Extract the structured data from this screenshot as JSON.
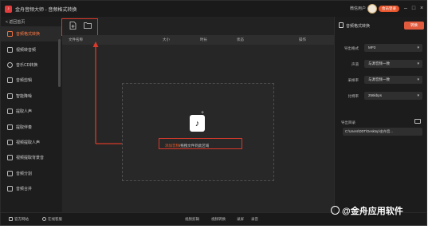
{
  "titlebar": {
    "title": "金舟音频大师 - 音频格式转换",
    "user_name": "微信用户",
    "vip_label": "会员登录",
    "minimize": "–",
    "maximize": "□",
    "close": "×"
  },
  "sidebar": {
    "back_label": "< 返回首页",
    "items": [
      {
        "label": "音频格式转换",
        "active": true
      },
      {
        "label": "视频转音频"
      },
      {
        "label": "音乐CD转换"
      },
      {
        "label": "音频剪辑"
      },
      {
        "label": "智能降噪"
      },
      {
        "label": "提取人声"
      },
      {
        "label": "提取伴奏"
      },
      {
        "label": "视频提取人声"
      },
      {
        "label": "视频提取背景音"
      },
      {
        "label": "音频分割"
      },
      {
        "label": "音频合并"
      }
    ]
  },
  "main": {
    "toolbar": {
      "add_file_icon": "add-file-icon",
      "add_folder_icon": "add-folder-icon"
    },
    "table_headers": [
      "文件名称",
      "大小",
      "时长",
      "状态",
      "操作"
    ],
    "dropzone": {
      "highlight": "添加音频",
      "text": "/拖拽文件到此区域"
    }
  },
  "right_panel": {
    "title": "音频格式转换",
    "convert_label": "转换",
    "fields": [
      {
        "label": "导出格式",
        "value": "MP3"
      },
      {
        "label": "声道",
        "value": "与源音频一致"
      },
      {
        "label": "采样率",
        "value": "与源音频一致"
      },
      {
        "label": "比特率",
        "value": "256kbps"
      }
    ],
    "output_label": "导出目录",
    "output_path": "C:\\Users\\DDT\\Desktop\\金舟音..."
  },
  "statusbar": {
    "left": [
      "官方网站",
      "在线客服"
    ],
    "right": [
      "视频剪辑",
      "视频转换",
      "录屏",
      "录音"
    ]
  },
  "watermark": "@金舟应用软件",
  "colors": {
    "accent": "#e85a2a",
    "annotation_red": "#d8392b",
    "bg": "#1f1f1f"
  }
}
